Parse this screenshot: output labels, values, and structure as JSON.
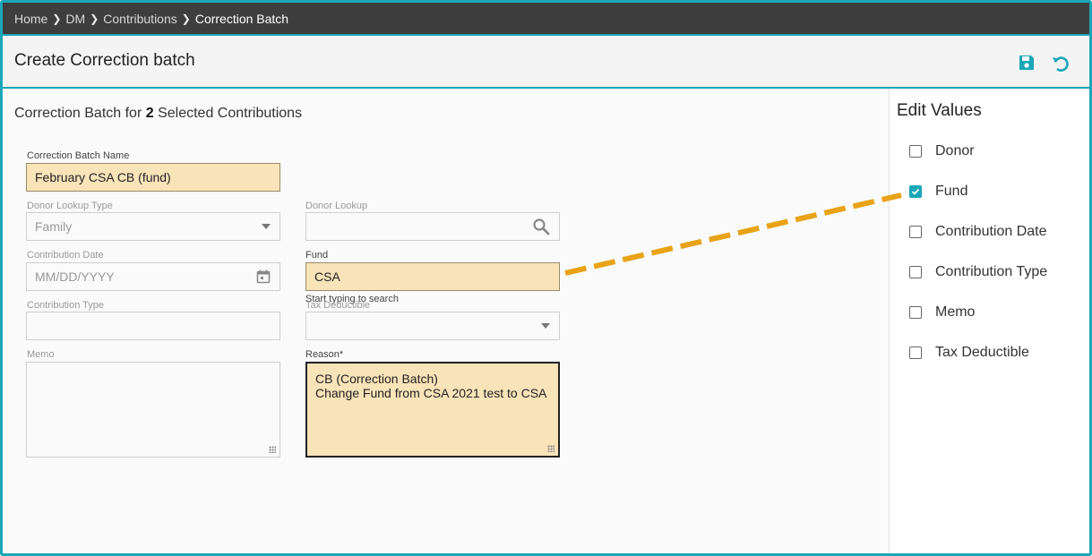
{
  "breadcrumb": {
    "items": [
      "Home",
      "DM",
      "Contributions",
      "Correction Batch"
    ]
  },
  "header": {
    "title": "Create Correction batch"
  },
  "subtitle": {
    "prefix": "Correction Batch for ",
    "count": "2",
    "suffix": " Selected Contributions"
  },
  "form": {
    "batch_name": {
      "label": "Correction Batch Name",
      "value": "February CSA CB (fund)"
    },
    "donor_lookup_type": {
      "label": "Donor Lookup Type",
      "value": "Family"
    },
    "donor_lookup": {
      "label": "Donor Lookup",
      "value": ""
    },
    "contribution_date": {
      "label": "Contribution Date",
      "placeholder": "MM/DD/YYYY"
    },
    "fund": {
      "label": "Fund",
      "value": "CSA",
      "hint": "Start typing to search"
    },
    "contribution_type": {
      "label": "Contribution Type",
      "value": ""
    },
    "tax_deductible": {
      "label": "Tax Deductible",
      "value": ""
    },
    "memo": {
      "label": "Memo",
      "value": ""
    },
    "reason": {
      "label": "Reason*",
      "line1": "CB (Correction Batch)",
      "line2": "Change Fund from CSA 2021 test to CSA"
    }
  },
  "edit_values": {
    "title": "Edit Values",
    "items": [
      {
        "label": "Donor",
        "checked": false
      },
      {
        "label": "Fund",
        "checked": true
      },
      {
        "label": "Contribution Date",
        "checked": false
      },
      {
        "label": "Contribution Type",
        "checked": false
      },
      {
        "label": "Memo",
        "checked": false
      },
      {
        "label": "Tax Deductible",
        "checked": false
      }
    ]
  },
  "colors": {
    "accent": "#1ba6b8",
    "highlight": "#f9e3b8",
    "annotation": "#e8a317"
  }
}
